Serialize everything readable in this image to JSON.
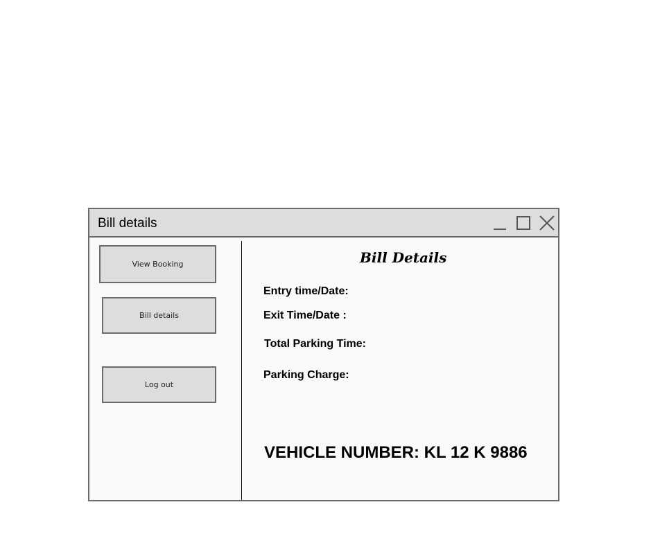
{
  "window": {
    "title": "Bill details",
    "controls": [
      "minimize-icon",
      "maximize-icon",
      "close-icon"
    ]
  },
  "sidebar": {
    "items": [
      {
        "label": "View Booking"
      },
      {
        "label": "Bill details"
      },
      {
        "label": "Log out"
      }
    ]
  },
  "main": {
    "heading": "Bill Details",
    "fields": {
      "entry": "Entry time/Date:",
      "exit": "Exit Time/Date :",
      "total_time": "Total Parking Time:",
      "charge": "Parking Charge:"
    },
    "vehicle_number": "VEHICLE NUMBER: KL 12 K 9886"
  },
  "colors": {
    "titlebar": "#dddddd",
    "border": "#6b6b6b",
    "window_bg": "#f9f9f9",
    "button_bg": "#dddddd"
  }
}
